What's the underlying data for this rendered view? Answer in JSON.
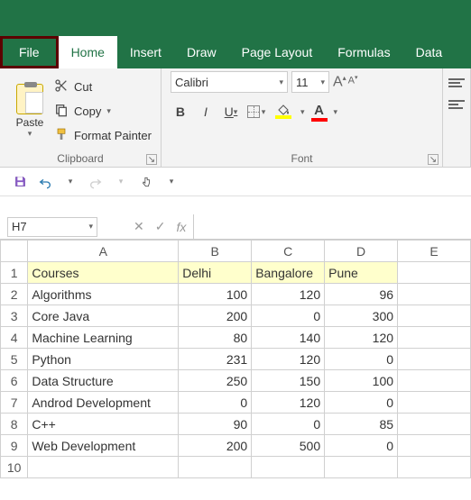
{
  "chart_data": {
    "type": "table",
    "headers": [
      "Courses",
      "Delhi",
      "Bangalore",
      "Pune"
    ],
    "rows": [
      [
        "Algorithms",
        100,
        120,
        96
      ],
      [
        "Core Java",
        200,
        0,
        300
      ],
      [
        "Machine Learning",
        80,
        140,
        120
      ],
      [
        "Python",
        231,
        120,
        0
      ],
      [
        "Data Structure",
        250,
        150,
        100
      ],
      [
        "Androd Development",
        0,
        120,
        0
      ],
      [
        "C++",
        90,
        0,
        85
      ],
      [
        "Web Development",
        200,
        500,
        0
      ]
    ]
  },
  "tabs": {
    "file": "File",
    "home": "Home",
    "insert": "Insert",
    "draw": "Draw",
    "pageLayout": "Page Layout",
    "formulas": "Formulas",
    "data": "Data"
  },
  "clipboard": {
    "paste": "Paste",
    "cut": "Cut",
    "copy": "Copy",
    "formatPainter": "Format Painter",
    "label": "Clipboard"
  },
  "font": {
    "name": "Calibri",
    "size": "11",
    "label": "Font"
  },
  "namebox": {
    "value": "H7"
  },
  "columns": [
    "A",
    "B",
    "C",
    "D",
    "E"
  ],
  "rowNumbers": [
    "1",
    "2",
    "3",
    "4",
    "5",
    "6",
    "7",
    "8",
    "9",
    "10"
  ],
  "cells": {
    "r1": {
      "A": "Courses",
      "B": "Delhi",
      "C": "Bangalore",
      "D": "Pune"
    },
    "r2": {
      "A": "Algorithms",
      "B": "100",
      "C": "120",
      "D": "96"
    },
    "r3": {
      "A": "Core Java",
      "B": "200",
      "C": "0",
      "D": "300"
    },
    "r4": {
      "A": "Machine Learning",
      "B": "80",
      "C": "140",
      "D": "120"
    },
    "r5": {
      "A": "Python",
      "B": "231",
      "C": "120",
      "D": "0"
    },
    "r6": {
      "A": "Data Structure",
      "B": "250",
      "C": "150",
      "D": "100"
    },
    "r7": {
      "A": "Androd Development",
      "B": "0",
      "C": "120",
      "D": "0"
    },
    "r8": {
      "A": "C++",
      "B": "90",
      "C": "0",
      "D": "85"
    },
    "r9": {
      "A": "Web Development",
      "B": "200",
      "C": "500",
      "D": "0"
    }
  }
}
